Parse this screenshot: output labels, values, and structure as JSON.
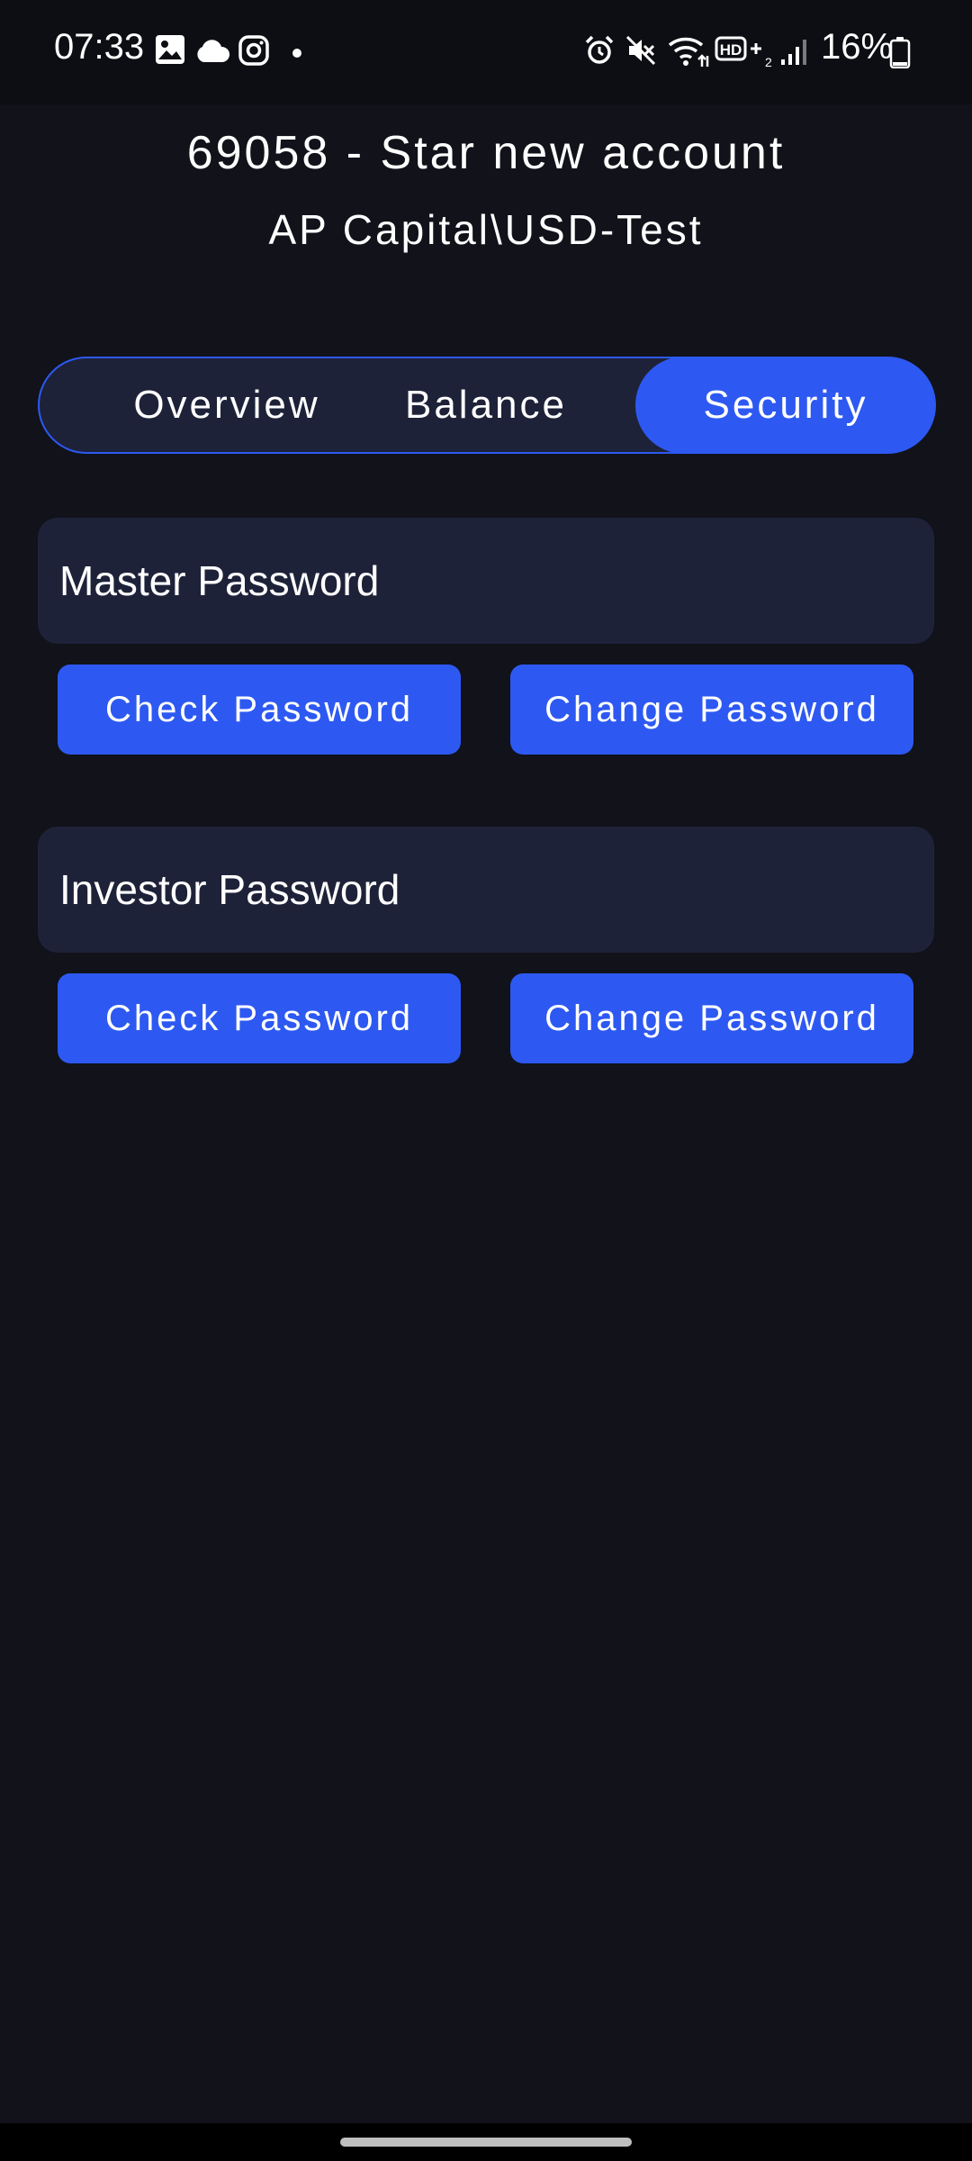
{
  "status_bar": {
    "time": "07:33",
    "battery_percent": "16%",
    "left_icons": [
      "gallery-icon",
      "cloud-icon",
      "instagram-icon",
      "dot-icon"
    ],
    "right_icons": [
      "alarm-icon",
      "mute-icon",
      "wifi-icon",
      "hd-plus-icon",
      "signal-icon",
      "battery-icon"
    ]
  },
  "header": {
    "title": "69058 - Star new account",
    "server": "AP Capital\\USD-Test"
  },
  "tabs": [
    {
      "label": "Overview",
      "active": false
    },
    {
      "label": "Balance",
      "active": false
    },
    {
      "label": "Security",
      "active": true
    }
  ],
  "sections": [
    {
      "label": "Master Password",
      "check_label": "Check Password",
      "change_label": "Change Password"
    },
    {
      "label": "Investor Password",
      "check_label": "Check Password",
      "change_label": "Change Password"
    }
  ],
  "colors": {
    "background": "#11121a",
    "card": "#1e2239",
    "accent": "#2d59f2",
    "text": "#ffffff"
  }
}
